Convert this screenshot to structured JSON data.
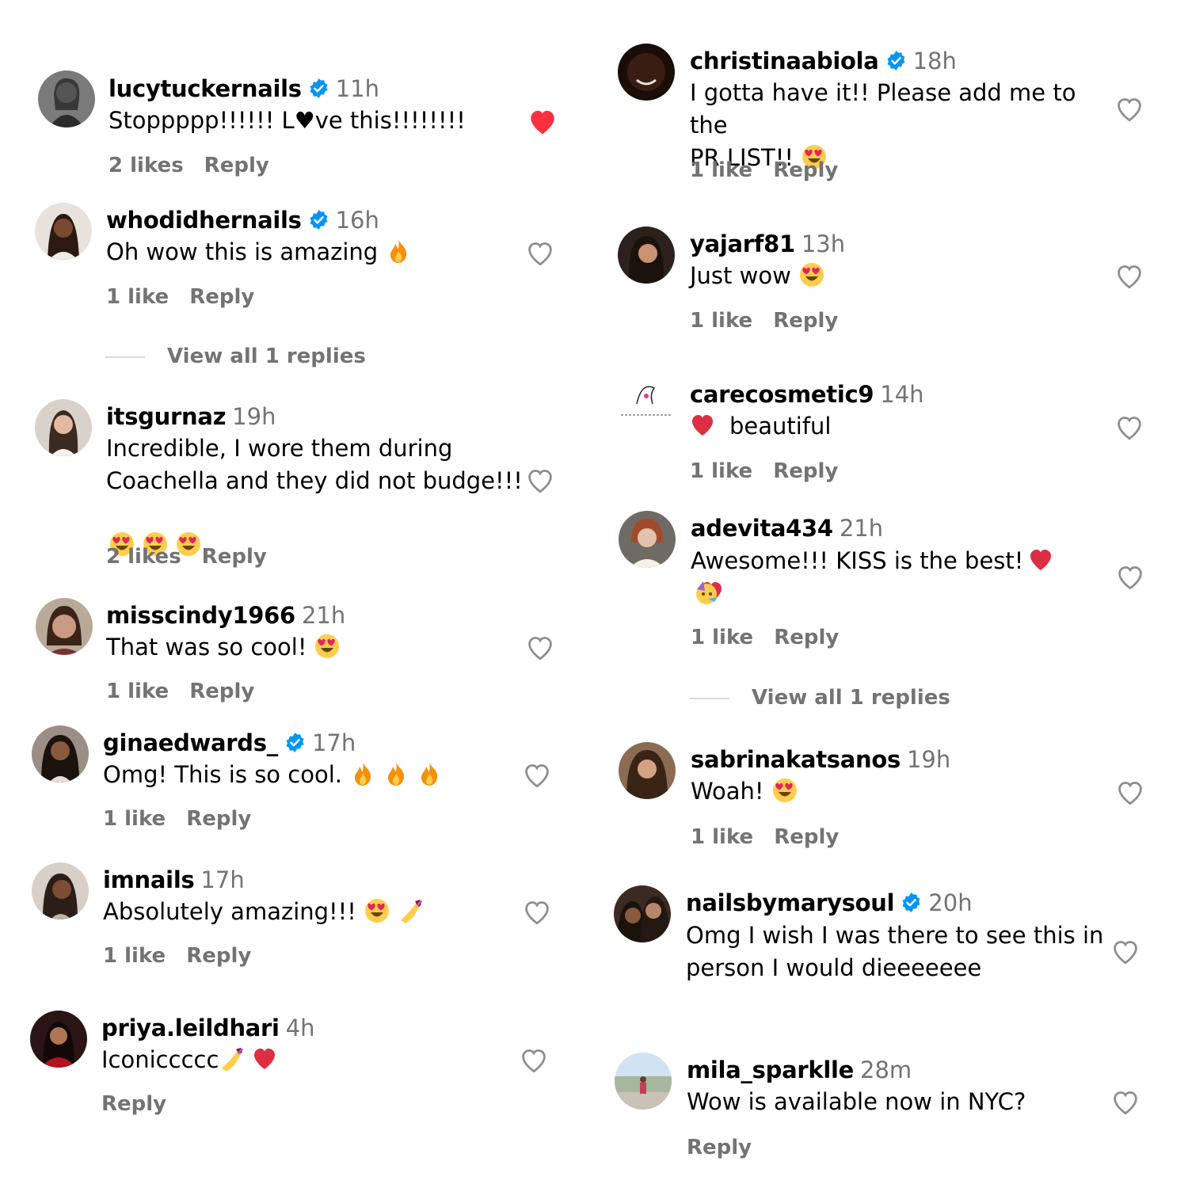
{
  "colors": {
    "muted": "#737373",
    "liked": "#ff3040",
    "verified": "#0095f6"
  },
  "left": [
    {
      "username": "lucytuckernails",
      "verified": true,
      "time": "11h",
      "text": "Stoppppp!!!!!! L♥ve this!!!!!!!!",
      "emojis": [],
      "likes": "2 likes",
      "reply": "Reply",
      "liked": true
    },
    {
      "username": "whodidhernails",
      "verified": true,
      "time": "16h",
      "text": "Oh wow this is amazing",
      "emojis": [
        "fire-emoji"
      ],
      "likes": "1 like",
      "reply": "Reply",
      "liked": false,
      "view_replies": "View all 1 replies"
    },
    {
      "username": "itsgurnaz",
      "verified": false,
      "time": "19h",
      "text": "Incredible, I wore them during\nCoachella and they did not budge!!!",
      "emojis": [
        "heart-eyes-emoji",
        "heart-eyes-emoji",
        "heart-eyes-emoji"
      ],
      "likes": "2 likes",
      "reply": "Reply",
      "liked": false
    },
    {
      "username": "misscindy1966",
      "verified": false,
      "time": "21h",
      "text": "That was so cool!",
      "emojis": [
        "heart-eyes-emoji"
      ],
      "likes": "1 like",
      "reply": "Reply",
      "liked": false
    },
    {
      "username": "ginaedwards_",
      "verified": true,
      "time": "17h",
      "text": "Omg! This is so cool.",
      "emojis": [
        "fire-emoji",
        "fire-emoji",
        "fire-emoji"
      ],
      "likes": "1 like",
      "reply": "Reply",
      "liked": false
    },
    {
      "username": "imnails",
      "verified": false,
      "time": "17h",
      "text": "Absolutely amazing!!!",
      "emojis": [
        "heart-eyes-emoji",
        "nail-polish-emoji"
      ],
      "likes": "1 like",
      "reply": "Reply",
      "liked": false
    },
    {
      "username": "priya.leildhari",
      "verified": false,
      "time": "4h",
      "text": "Iconiccccc",
      "emojis": [
        "nail-polish-emoji",
        "red-heart-emoji"
      ],
      "likes": "",
      "reply": "Reply",
      "liked": false
    }
  ],
  "right": [
    {
      "username": "christinaabiola",
      "verified": true,
      "time": "18h",
      "text": "I gotta have it!! Please add me to the\nPR LIST!!",
      "emojis": [
        "heart-eyes-emoji"
      ],
      "likes": "1 like",
      "reply": "Reply",
      "liked": false
    },
    {
      "username": "yajarf81",
      "verified": false,
      "time": "13h",
      "text": "Just wow",
      "emojis": [
        "heart-eyes-emoji"
      ],
      "likes": "1 like",
      "reply": "Reply",
      "liked": false
    },
    {
      "username": "carecosmetic9",
      "verified": false,
      "time": "14h",
      "text": "beautiful",
      "emojis_before": [
        "red-heart-emoji"
      ],
      "emojis": [],
      "likes": "1 like",
      "reply": "Reply",
      "liked": false
    },
    {
      "username": "adevita434",
      "verified": false,
      "time": "21h",
      "text": "Awesome!!! KISS is the best!",
      "emojis": [
        "red-heart-emoji",
        "red-heart-emoji",
        "partying-face-emoji"
      ],
      "likes": "1 like",
      "reply": "Reply",
      "liked": false,
      "view_replies": "View all 1 replies"
    },
    {
      "username": "sabrinakatsanos",
      "verified": false,
      "time": "19h",
      "text": "Woah!",
      "emojis": [
        "heart-eyes-emoji"
      ],
      "likes": "1 like",
      "reply": "Reply",
      "liked": false
    },
    {
      "username": "nailsbymarysoul",
      "verified": true,
      "time": "20h",
      "text": "Omg I wish I was there to see this in\nperson I would dieeeeeee",
      "emojis": [],
      "likes": "",
      "reply": "",
      "liked": false
    },
    {
      "username": "mila_sparklle",
      "verified": false,
      "time": "28m",
      "text": "Wow is available now in NYC?",
      "emojis": [],
      "likes": "",
      "reply": "Reply",
      "liked": false
    }
  ]
}
